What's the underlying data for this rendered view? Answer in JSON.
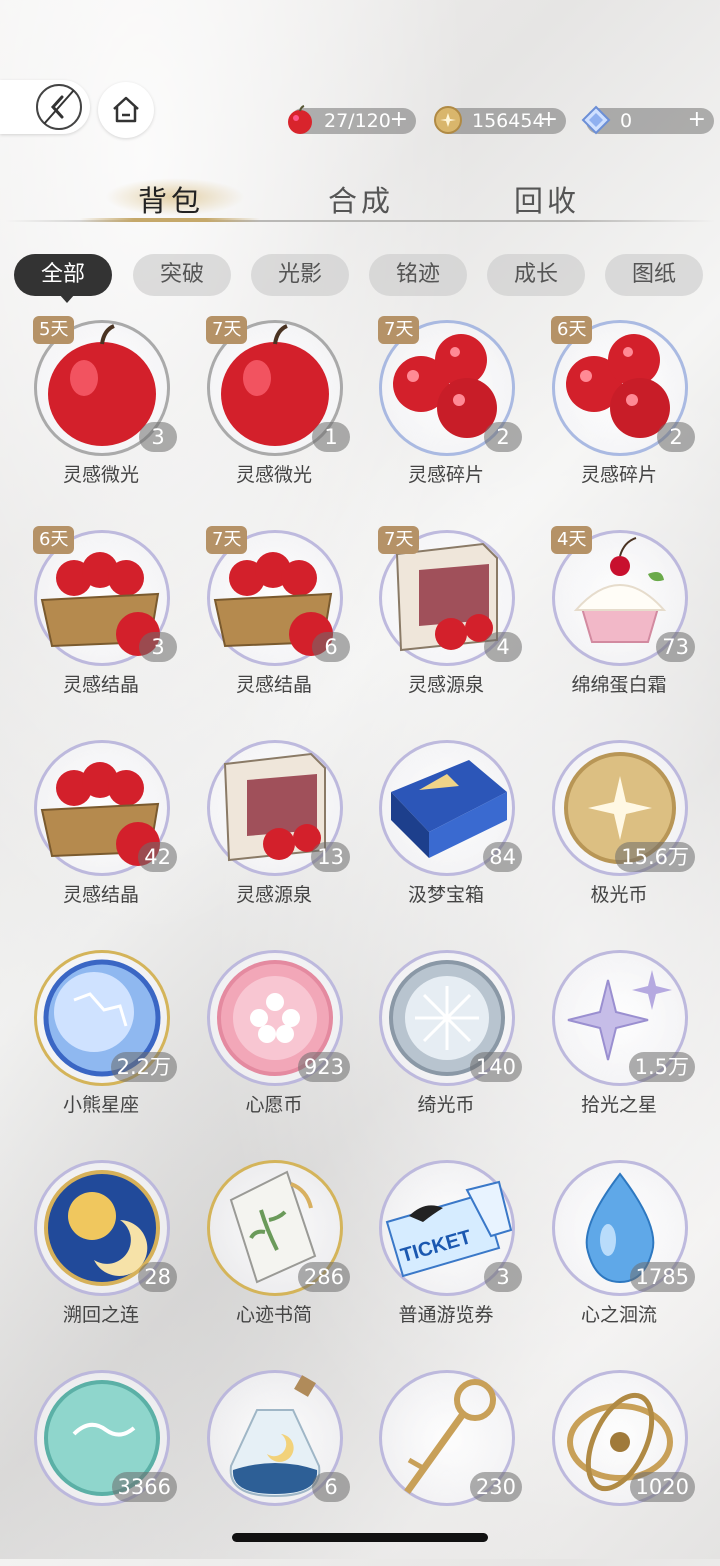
{
  "header": {
    "resources": [
      {
        "icon": "apple-icon",
        "value": "27/120",
        "plus": "+"
      },
      {
        "icon": "gold-coin-icon",
        "value": "156454",
        "plus": "+"
      },
      {
        "icon": "diamond-icon",
        "value": "0",
        "plus": "+"
      }
    ]
  },
  "tabs": [
    {
      "label": "背包"
    },
    {
      "label": "合成"
    },
    {
      "label": "回收"
    }
  ],
  "filters": [
    {
      "label": "全部"
    },
    {
      "label": "突破"
    },
    {
      "label": "光影"
    },
    {
      "label": "铭迹"
    },
    {
      "label": "成长"
    },
    {
      "label": "图纸"
    }
  ],
  "items": [
    {
      "name": "灵感微光",
      "count": "3",
      "badge": "5天",
      "art": "big-apple"
    },
    {
      "name": "灵感微光",
      "count": "1",
      "badge": "7天",
      "art": "big-apple"
    },
    {
      "name": "灵感碎片",
      "count": "2",
      "badge": "7天",
      "art": "apples"
    },
    {
      "name": "灵感碎片",
      "count": "2",
      "badge": "6天",
      "art": "apples"
    },
    {
      "name": "灵感结晶",
      "count": "3",
      "badge": "6天",
      "art": "apple-basket"
    },
    {
      "name": "灵感结晶",
      "count": "6",
      "badge": "7天",
      "art": "apple-basket"
    },
    {
      "name": "灵感源泉",
      "count": "4",
      "badge": "7天",
      "art": "apple-box"
    },
    {
      "name": "绵绵蛋白霜",
      "count": "73",
      "badge": "4天",
      "art": "cupcake"
    },
    {
      "name": "灵感结晶",
      "count": "42",
      "badge": "",
      "art": "apple-basket"
    },
    {
      "name": "灵感源泉",
      "count": "13",
      "badge": "",
      "art": "apple-box"
    },
    {
      "name": "汲梦宝箱",
      "count": "84",
      "badge": "",
      "art": "blue-chest"
    },
    {
      "name": "极光币",
      "count": "15.6万",
      "badge": "",
      "art": "gold-coin"
    },
    {
      "name": "小熊星座",
      "count": "2.2万",
      "badge": "",
      "art": "constellation-coin"
    },
    {
      "name": "心愿币",
      "count": "923",
      "badge": "",
      "art": "pink-coin"
    },
    {
      "name": "绮光币",
      "count": "140",
      "badge": "",
      "art": "silver-coin"
    },
    {
      "name": "拾光之星",
      "count": "1.5万",
      "badge": "",
      "art": "star"
    },
    {
      "name": "溯回之连",
      "count": "28",
      "badge": "",
      "art": "sun-moon-medal"
    },
    {
      "name": "心迹书简",
      "count": "286",
      "badge": "",
      "art": "letter"
    },
    {
      "name": "普通游览券",
      "count": "3",
      "badge": "",
      "art": "ticket"
    },
    {
      "name": "心之洄流",
      "count": "1785",
      "badge": "",
      "art": "drop"
    },
    {
      "name": "",
      "count": "3366",
      "badge": "",
      "art": "teal-coin"
    },
    {
      "name": "",
      "count": "6",
      "badge": "",
      "art": "moon-bottle"
    },
    {
      "name": "",
      "count": "230",
      "badge": "",
      "art": "key"
    },
    {
      "name": "",
      "count": "1020",
      "badge": "",
      "art": "astrolabe"
    }
  ],
  "ticket_text": "TICKET",
  "colors": {
    "accent": "#c5a86a",
    "chip_active": "#333333",
    "badge": "#b59267"
  }
}
